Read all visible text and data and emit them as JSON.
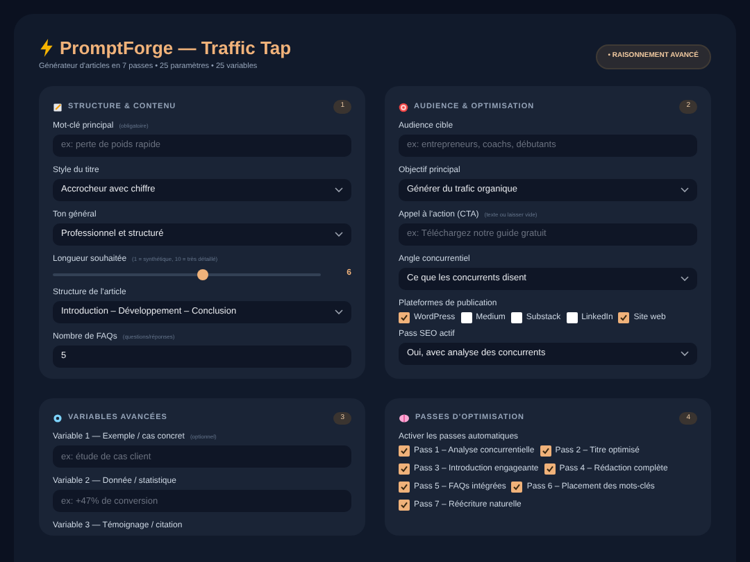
{
  "header": {
    "title": "PromptForge — Traffic Tap",
    "subtitle": "Générateur d'articles en 7 passes • 25 paramètres • 25 variables",
    "badge": "• RAISONNEMENT AVANCÉ"
  },
  "sections": [
    {
      "title": "STRUCTURE & CONTENU",
      "number": "1",
      "fields": [
        {
          "kind": "input",
          "label": "Mot-clé principal",
          "hint": "(obligatoire)",
          "placeholder": "ex: perte de poids rapide"
        },
        {
          "kind": "select",
          "label": "Style du titre",
          "value": "Accrocheur avec chiffre"
        },
        {
          "kind": "select",
          "label": "Ton général",
          "value": "Professionnel et structuré"
        },
        {
          "kind": "slider",
          "label": "Longueur souhaitée",
          "hint": "(1 = synthétique, 10 = très détaillé)",
          "level": 0.56,
          "reading": "6"
        },
        {
          "kind": "select",
          "label": "Structure de l'article",
          "value": "Introduction – Développement – Conclusion"
        },
        {
          "kind": "input",
          "label": "Nombre de FAQs",
          "hint": "(questions/réponses)",
          "value": "5"
        }
      ]
    },
    {
      "title": "AUDIENCE & OPTIMISATION",
      "number": "2",
      "fields": [
        {
          "kind": "input",
          "label": "Audience cible",
          "placeholder": "ex: entrepreneurs, coachs, débutants"
        },
        {
          "kind": "select",
          "label": "Objectif principal",
          "value": "Générer du trafic organique"
        },
        {
          "kind": "input",
          "label": "Appel à l'action (CTA)",
          "hint": "(texte ou laisser vide)",
          "placeholder": "ex: Téléchargez notre guide gratuit"
        },
        {
          "kind": "select",
          "label": "Angle concurrentiel",
          "value": "Ce que les concurrents disent"
        },
        {
          "kind": "checks",
          "label": "Plateformes de publication",
          "options": [
            {
              "label": "WordPress",
              "checked": true
            },
            {
              "label": "Medium",
              "checked": false
            },
            {
              "label": "Substack",
              "checked": false
            },
            {
              "label": "LinkedIn",
              "checked": false
            },
            {
              "label": "Site web",
              "checked": true
            }
          ]
        },
        {
          "kind": "select",
          "label": "Pass SEO actif",
          "value": "Oui, avec analyse des concurrents"
        }
      ]
    },
    {
      "title": "VARIABLES AVANCÉES",
      "number": "3",
      "fields": [
        {
          "kind": "input",
          "label": "Variable 1 — Exemple / cas concret",
          "hint": "(optionnel)",
          "placeholder": "ex: étude de cas client"
        },
        {
          "kind": "input",
          "label": "Variable 2 — Donnée / statistique",
          "placeholder": "ex: +47% de conversion"
        },
        {
          "kind": "label",
          "label": "Variable 3 — Témoignage / citation"
        }
      ]
    },
    {
      "title": "PASSES D'OPTIMISATION",
      "number": "4",
      "fields": [
        {
          "kind": "checks",
          "label": "Activer les passes automatiques",
          "options": [
            {
              "label": "Pass 1 – Analyse concurrentielle",
              "checked": true
            },
            {
              "label": "Pass 2 – Titre optimisé",
              "checked": true
            },
            {
              "label": "Pass 3 – Introduction engageante",
              "checked": true
            },
            {
              "label": "Pass 4 – Rédaction complète",
              "checked": true
            },
            {
              "label": "Pass 5 – FAQs intégrées",
              "checked": true
            },
            {
              "label": "Pass 6 – Placement des mots-clés",
              "checked": true
            },
            {
              "label": "Pass 7 – Réécriture naturelle",
              "checked": true
            }
          ]
        }
      ]
    }
  ]
}
